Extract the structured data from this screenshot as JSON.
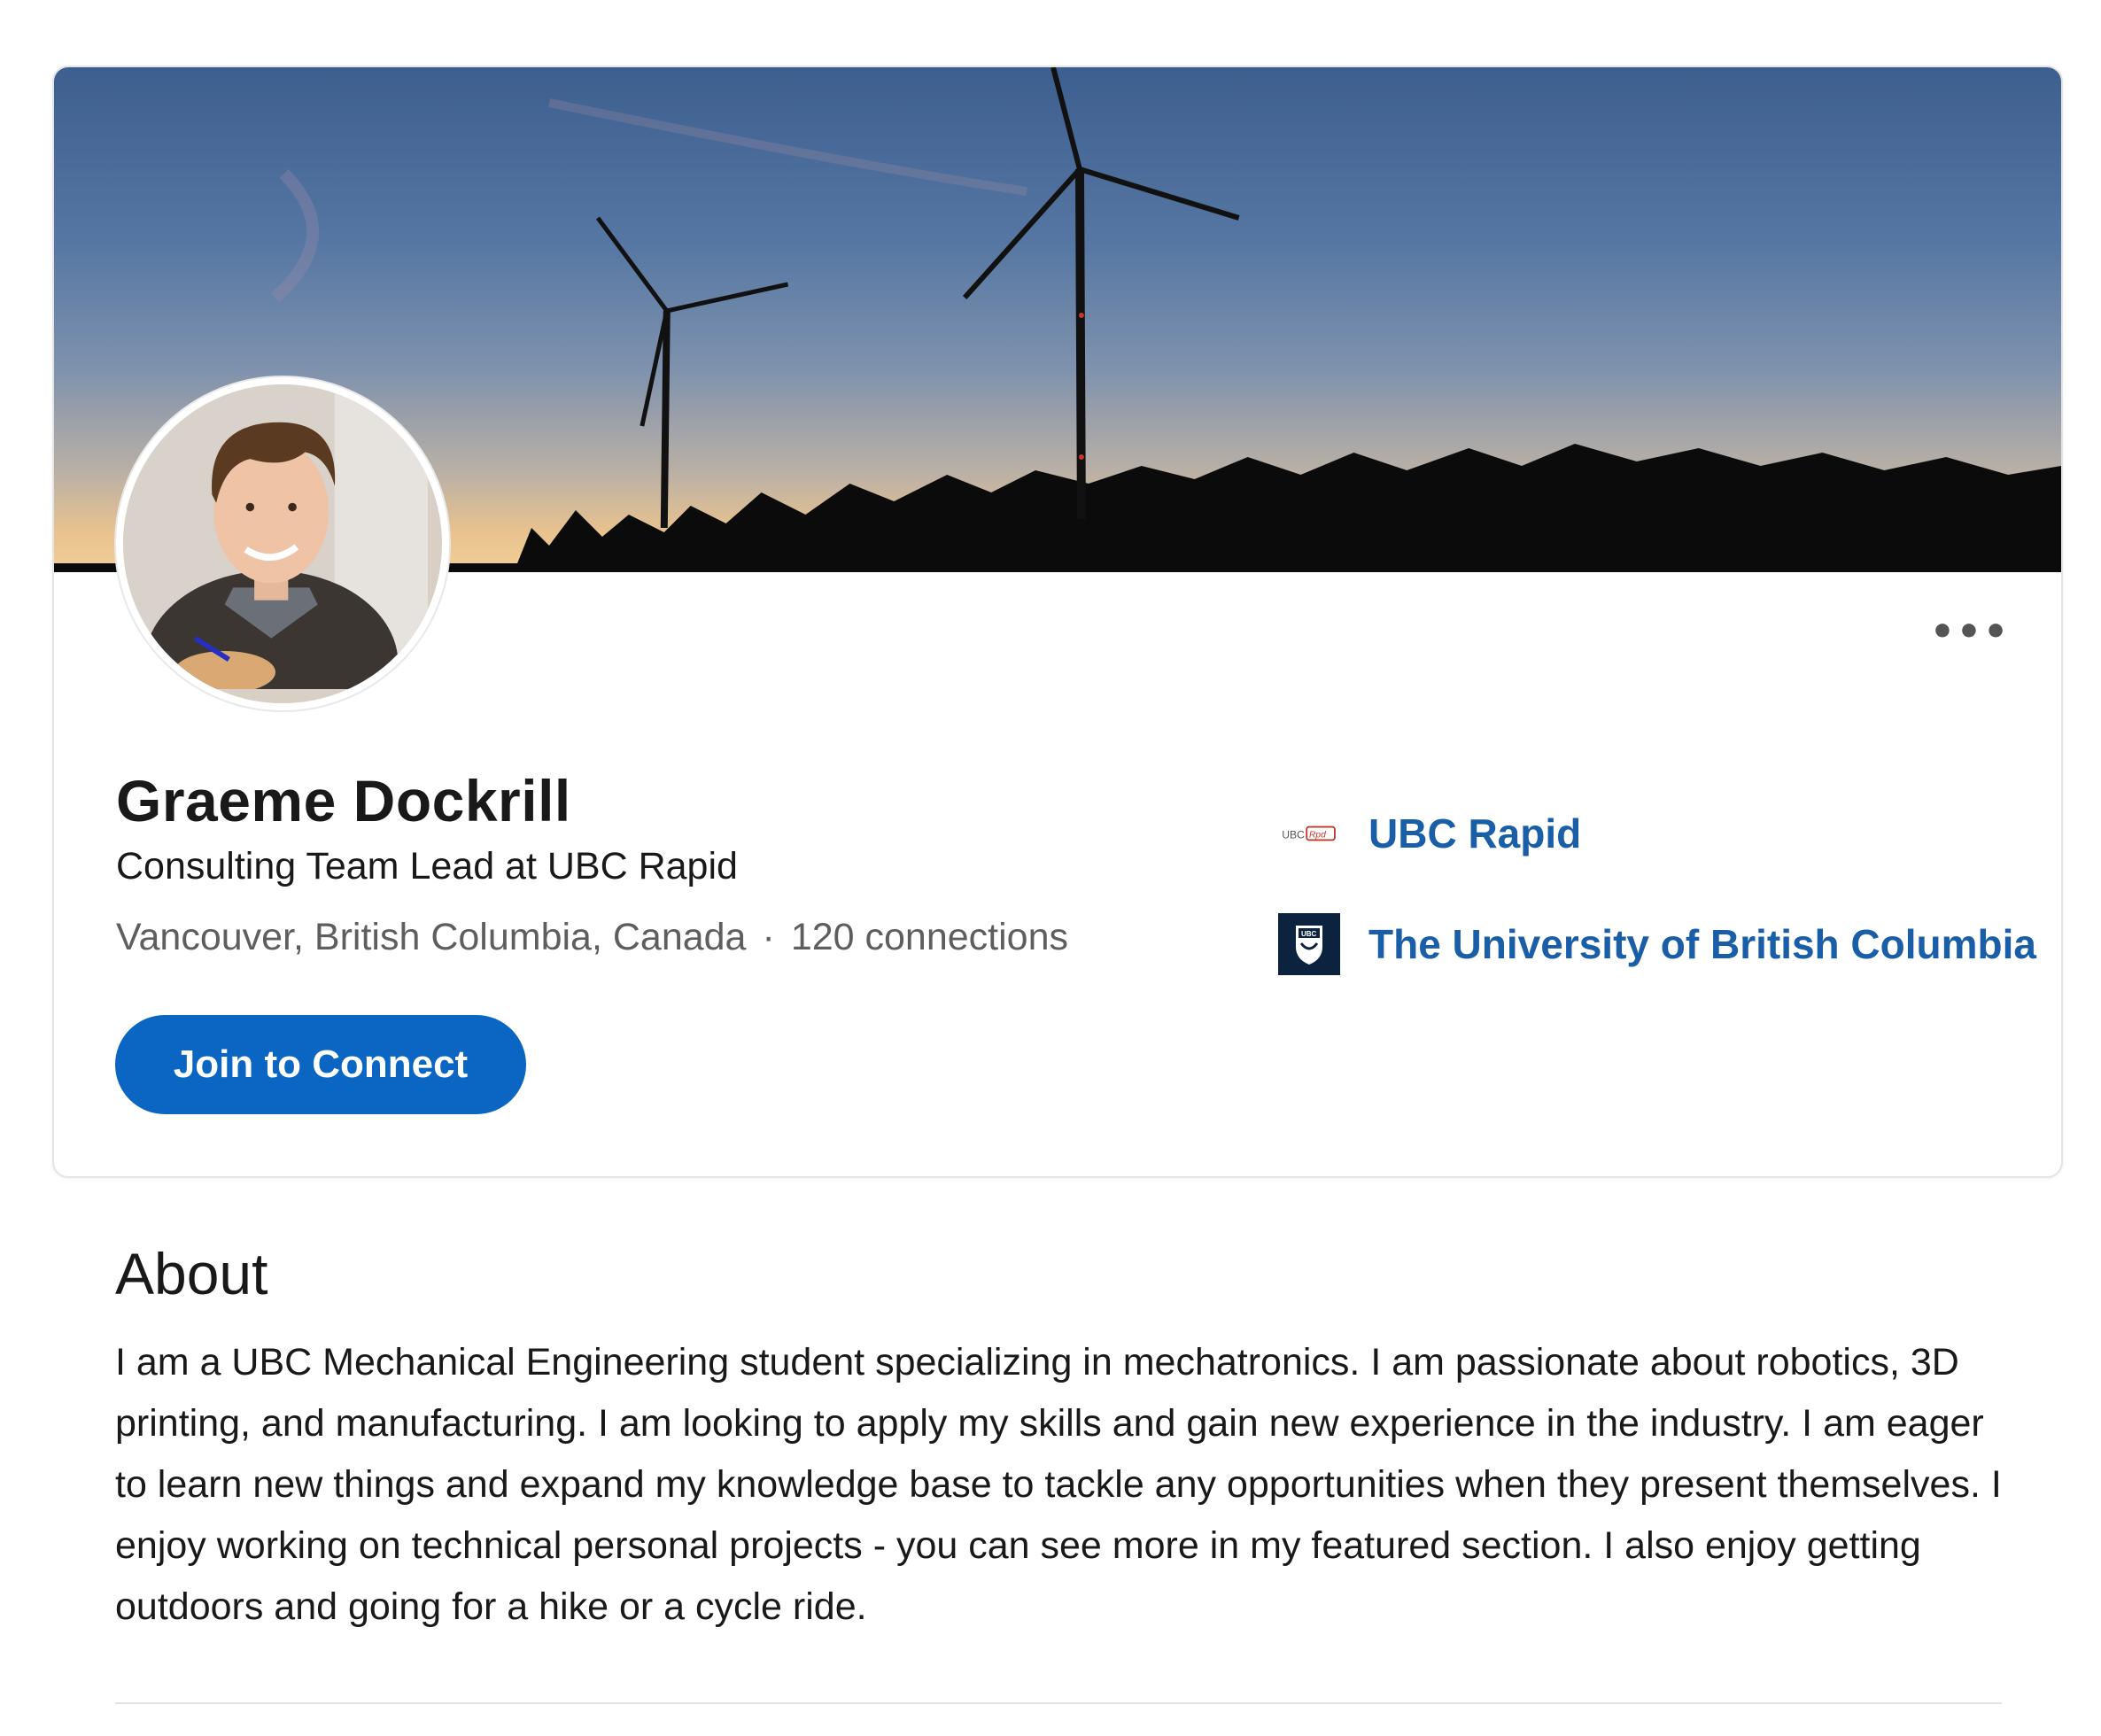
{
  "profile": {
    "name": "Graeme Dockrill",
    "headline": "Consulting Team Lead at UBC Rapid",
    "location": "Vancouver, British Columbia, Canada",
    "separator": "·",
    "connections": "120 connections",
    "connect_label": "Join to Connect",
    "more_label": "•••"
  },
  "affiliations": [
    {
      "label": "UBC Rapid",
      "logo": "ubc-rapid-logo"
    },
    {
      "label": "The University of British Columbia",
      "logo": "ubc-crest-logo"
    }
  ],
  "about": {
    "title": "About",
    "text": "I am a UBC Mechanical Engineering student specializing in mechatronics. I am passionate about robotics, 3D printing, and manufacturing. I am looking to apply my skills and gain new experience in the industry. I am eager to learn new things and expand my knowledge base to tackle any opportunities when they present themselves. I enjoy working on technical personal projects - you can see more in my featured section. I also enjoy getting outdoors and going for a hike or a cycle ride."
  },
  "colors": {
    "accent": "#0a66c2",
    "link": "#1a5ea8",
    "ubc_navy": "#0c2340"
  }
}
